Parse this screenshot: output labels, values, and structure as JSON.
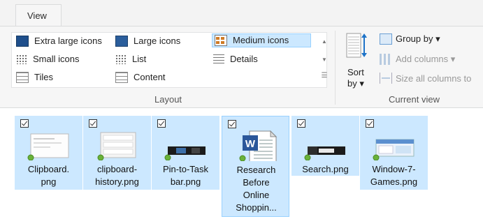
{
  "ribbon": {
    "tab_label": "View",
    "layout": {
      "options": [
        {
          "label": "Extra large icons",
          "icon": "extra-large-icons-icon"
        },
        {
          "label": "Large icons",
          "icon": "large-icons-icon"
        },
        {
          "label": "Medium icons",
          "icon": "medium-icons-icon",
          "selected": true
        },
        {
          "label": "Small icons",
          "icon": "small-icons-icon"
        },
        {
          "label": "List",
          "icon": "list-icon"
        },
        {
          "label": "Details",
          "icon": "details-icon"
        },
        {
          "label": "Tiles",
          "icon": "tiles-icon"
        },
        {
          "label": "Content",
          "icon": "content-icon"
        }
      ],
      "group_label": "Layout"
    },
    "current_view": {
      "sort_label_1": "Sort",
      "sort_label_2": "by ▾",
      "group_by": "Group by ▾",
      "add_columns": "Add columns ▾",
      "size_columns": "Size all columns to",
      "group_label": "Current view"
    }
  },
  "files": [
    {
      "name_lines": [
        "Clipboard.",
        "png"
      ],
      "checked": true
    },
    {
      "name_lines": [
        "clipboard-",
        "history.png"
      ],
      "checked": true
    },
    {
      "name_lines": [
        "Pin-to-Task",
        "bar.png"
      ],
      "checked": true
    },
    {
      "name_lines": [
        "Research",
        "Before",
        "Online",
        "Shoppin..."
      ],
      "checked": true,
      "focused": true
    },
    {
      "name_lines": [
        "Search.png"
      ],
      "checked": true
    },
    {
      "name_lines": [
        "Window-7-",
        "Games.png"
      ],
      "checked": true
    }
  ],
  "colors": {
    "selection": "#cce8ff",
    "selection_border": "#99d1ff",
    "word_blue": "#2b579a"
  }
}
